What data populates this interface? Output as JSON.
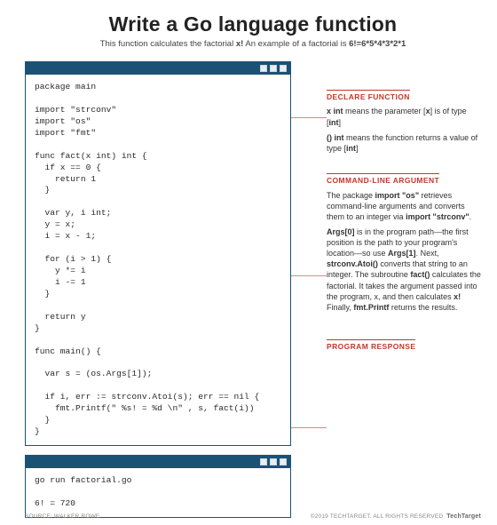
{
  "header": {
    "title": "Write a Go language function",
    "subtitle_pre": "This function calculates the factorial ",
    "subtitle_b1": "x!",
    "subtitle_mid": " An example of a factorial is ",
    "subtitle_b2": "6!=6*5*4*3*2*1"
  },
  "code_main": "package main\n\nimport \"strconv\"\nimport \"os\"\nimport \"fmt\"\n\nfunc fact(x int) int {\n  if x == 0 {\n    return 1\n  }\n\n  var y, i int;\n  y = x;\n  i = x - 1;\n\n  for (i > 1) {\n    y *= i\n    i -= 1\n  }\n\n  return y\n}\n\nfunc main() {\n\n  var s = (os.Args[1]);\n\n  if i, err := strconv.Atoi(s); err == nil {\n    fmt.Printf(\" %s! = %d \\n\" , s, fact(i))\n  }\n}",
  "code_run": "go run factorial.go\n\n6! = 720",
  "ann": {
    "declare": {
      "head": "DECLARE FUNCTION",
      "p1a": "x int",
      "p1b": " means the parameter [",
      "p1c": "x",
      "p1d": "] is of type [",
      "p1e": "int",
      "p1f": "]",
      "p2a": "() int",
      "p2b": "  means the function returns a value of type [",
      "p2c": "int",
      "p2d": "]"
    },
    "cmd": {
      "head": "COMMAND-LINE ARGUMENT",
      "p1a": "The package ",
      "p1b": "import \"os\"",
      "p1c": " retrieves command-line arguments and converts them to an integer via ",
      "p1d": "import \"strconv\"",
      "p1e": ".",
      "p2a": "Args[0]",
      "p2b": " is in the program path—the first position is the path to your program's location—so use ",
      "p2c": "Args[1]",
      "p2d": ". Next, ",
      "p2e": "strconv.Atoi()",
      "p2f": " converts that string to an integer. The subroutine ",
      "p2g": "fact()",
      "p2h": " calculates the factorial.  It takes the argument passed into the program, x, and then calculates ",
      "p2i": "x!",
      "p2j": " Finally, ",
      "p2k": "fmt.Printf",
      "p2l": " returns the results."
    },
    "resp": {
      "head": "PROGRAM RESPONSE"
    }
  },
  "footer": {
    "left": "SOURCE: WALKER ROWE",
    "right_pre": "©2019 TECHTARGET. ALL RIGHTS RESERVED",
    "brand": "TechTarget"
  }
}
